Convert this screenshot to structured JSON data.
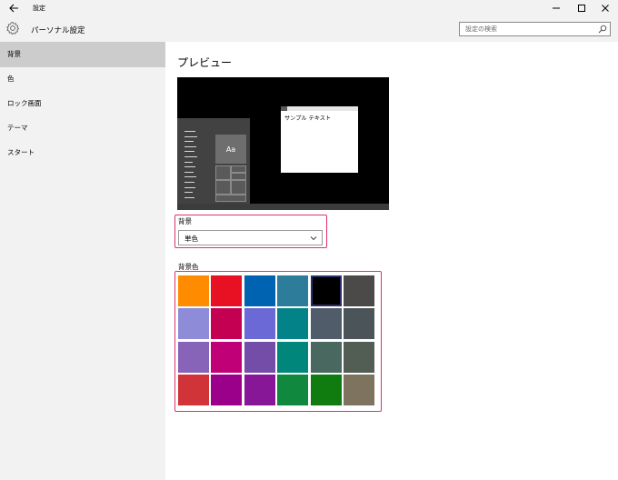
{
  "window": {
    "title": "設定"
  },
  "header": {
    "title": "パーソナル設定",
    "search_placeholder": "設定の検索"
  },
  "sidebar": {
    "items": [
      {
        "label": "背景"
      },
      {
        "label": "色"
      },
      {
        "label": "ロック画面"
      },
      {
        "label": "テーマ"
      },
      {
        "label": "スタート"
      }
    ],
    "selected_index": 0
  },
  "main": {
    "page_title": "プレビュー",
    "preview": {
      "tile_label": "Aa",
      "sample_text": "サンプル テキスト"
    },
    "background": {
      "label": "背景",
      "selected_value": "単色"
    },
    "background_color": {
      "label": "背景色",
      "selected_index": 4,
      "swatches": [
        "#ff8c00",
        "#e81123",
        "#0063b1",
        "#2d7d9a",
        "#000000",
        "#4c4a48",
        "#8e8cd8",
        "#c30052",
        "#6b69d6",
        "#038387",
        "#515c6b",
        "#4a5459",
        "#8764b8",
        "#bf0077",
        "#744da9",
        "#00867a",
        "#486860",
        "#525e54",
        "#d13438",
        "#9a0089",
        "#881798",
        "#10893e",
        "#107c10",
        "#7e735f"
      ]
    }
  },
  "colors": {
    "chrome_bg": "#f2f2f2",
    "sidebar_selected": "#cccccc",
    "highlight_border": "#e0306e"
  }
}
